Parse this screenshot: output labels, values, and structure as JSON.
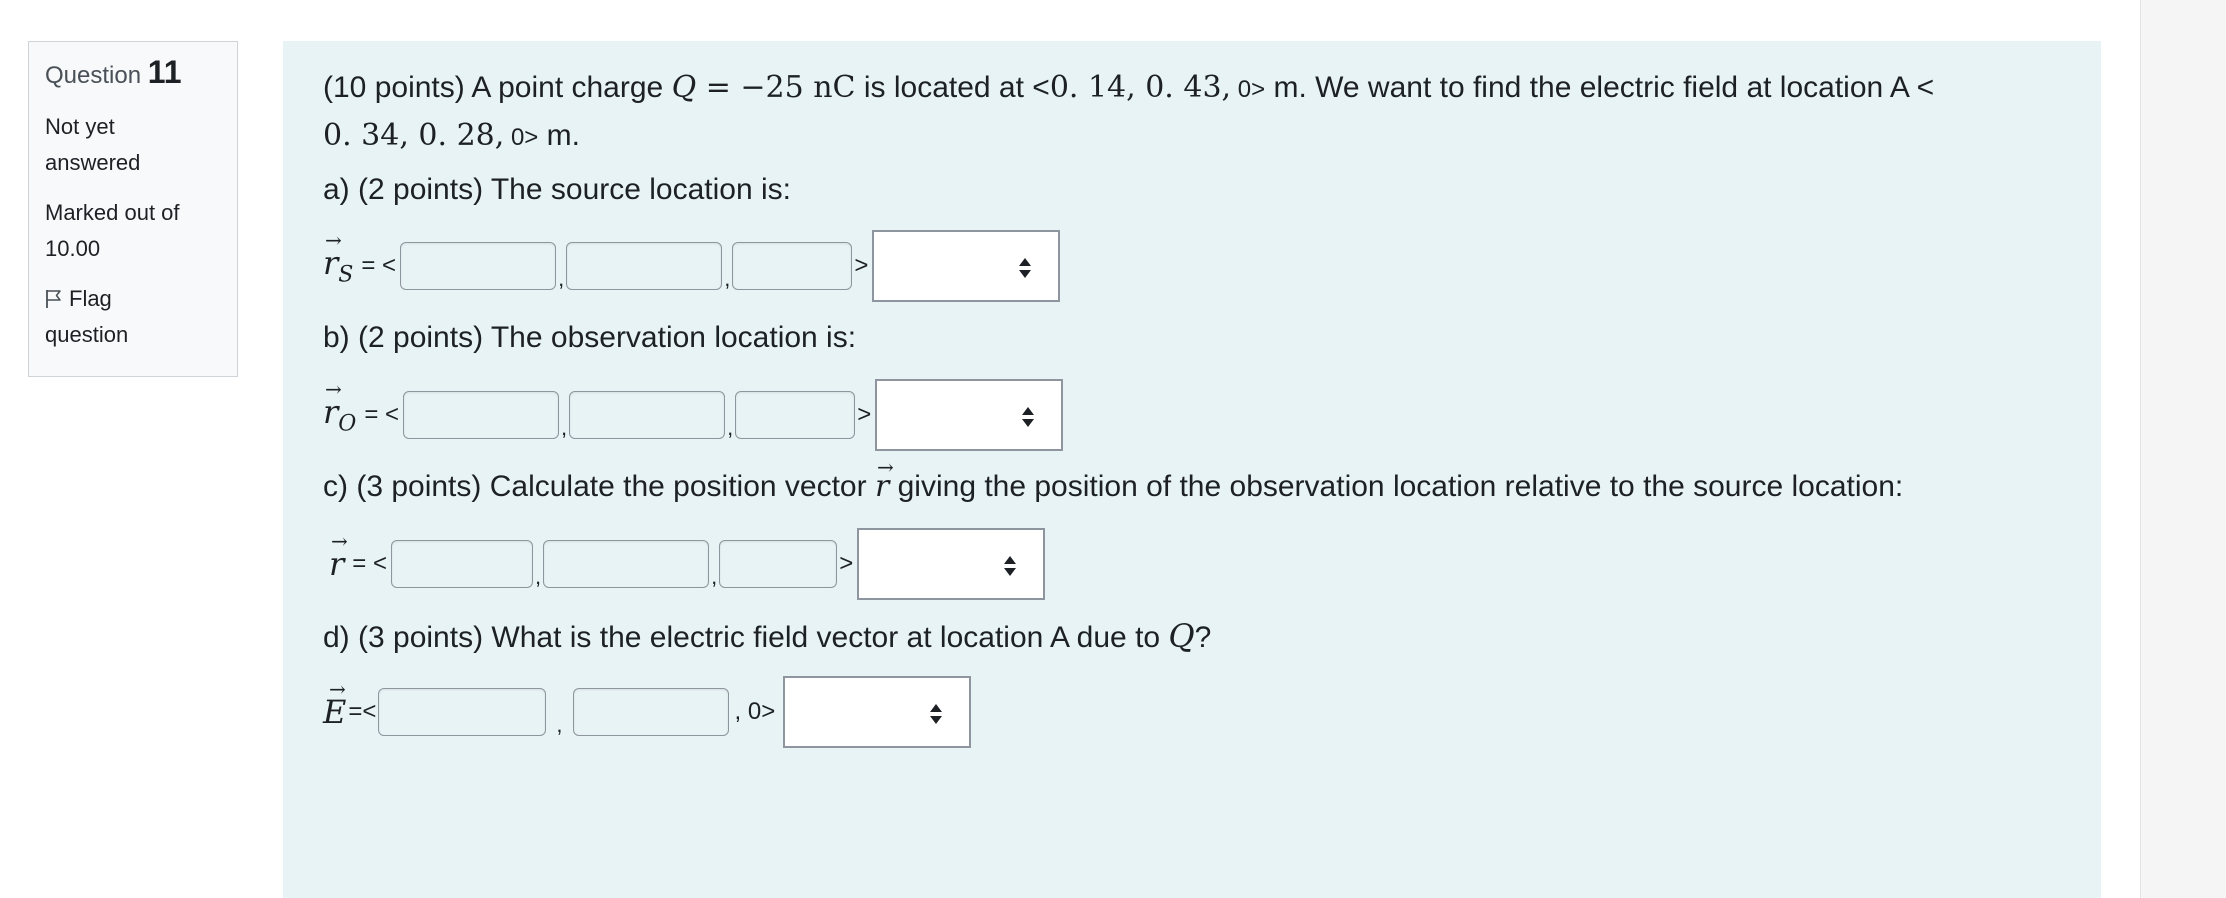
{
  "info": {
    "question_word": "Question",
    "question_number": "11",
    "state_line1": "Not yet",
    "state_line2": "answered",
    "grade_line1": "Marked out of",
    "grade_line2": "10.00",
    "flag_line1": "Flag",
    "flag_line2": "question"
  },
  "question": {
    "prefix": "(10 points) A point charge ",
    "charge_symbol": "Q",
    "charge_value": " = −25",
    "charge_unit": " nC",
    "located_at": " is located at <",
    "source_coords": "0. 14, 0. 43,",
    "source_zero": " 0>",
    "find_text": " m. We want to find the electric field at location A <",
    "obs_coords": "0. 34, 0. 28,",
    "obs_zero": " 0>",
    "end_text": " m."
  },
  "parts": {
    "a_label": "a) (2 points) The source location is:",
    "b_label": "b) (2 points) The observation location is:",
    "c_label": "c) (3 points) Calculate the position vector ",
    "c_symbol": "r",
    "c_label_rest": " giving the position of the observation location relative to the source location:",
    "d_label": "d)  (3 points) What is the electric field vector at location A due to ",
    "d_symbol": "Q",
    "d_label_end": "?"
  },
  "rows": {
    "rs_symbol": "r",
    "rs_sub": "S",
    "ro_symbol": "r",
    "ro_sub": "O",
    "r_symbol": "r",
    "e_symbol": "E",
    "eq_open": "= <",
    "e_eq_open": "=<",
    "comma": ",",
    "close": ">",
    "e_tail": ", 0>"
  },
  "icons": {
    "flag": "flag-icon",
    "select_arrows": "sort-arrows-icon",
    "vector_arrow": "vector-arrow"
  },
  "colors": {
    "content_bg": "#e7f3f5",
    "info_bg": "#f8f9fa",
    "border": "#8f959e"
  }
}
